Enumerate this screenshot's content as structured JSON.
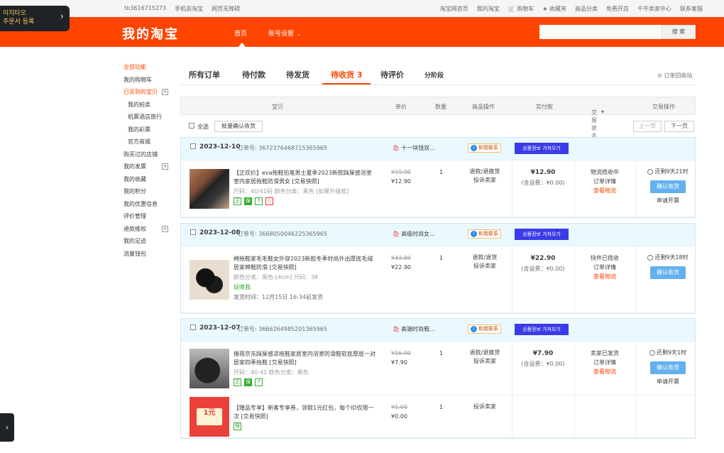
{
  "topbar": {
    "left": [
      "tb3616715273",
      "手机逛淘宝",
      "网页无障碍"
    ],
    "right": [
      "淘宝网首页",
      "我的淘宝",
      "购物车",
      "收藏夹",
      "商品分类",
      "免费开店",
      "千牛卖家中心",
      "联系客服"
    ]
  },
  "promo": {
    "line1": "이지타오",
    "line2": "주문서 등록",
    "arrow": "›"
  },
  "header": {
    "brand": "我的淘宝",
    "nav": [
      {
        "label": "首页"
      },
      {
        "label": "账号设置"
      }
    ],
    "nav_caret": "⌄",
    "search_btn": "搜 索"
  },
  "sidebar": {
    "items": [
      {
        "label": "全部功能",
        "style": "red"
      },
      {
        "label": "我的购物车",
        "style": ""
      },
      {
        "label": "已买到的宝贝",
        "style": "red",
        "plus": true
      },
      {
        "label": "我的拍卖",
        "style": "sub"
      },
      {
        "label": "机票酒店旅行",
        "style": "sub"
      },
      {
        "label": "我的彩票",
        "style": "sub"
      },
      {
        "label": "官方商城",
        "style": "sub"
      },
      {
        "label": "购买过的店铺",
        "style": ""
      },
      {
        "label": "我的发票",
        "style": "",
        "plus": true
      },
      {
        "label": "我的收藏",
        "style": ""
      },
      {
        "label": "我的积分",
        "style": ""
      },
      {
        "label": "我的优惠信息",
        "style": ""
      },
      {
        "label": "评价管理",
        "style": ""
      },
      {
        "label": "退款维权",
        "style": "",
        "plus": true
      },
      {
        "label": "我的足迹",
        "style": ""
      },
      {
        "label": "流量钱包",
        "style": ""
      }
    ]
  },
  "tabs": [
    {
      "label": "所有订单"
    },
    {
      "label": "待付款"
    },
    {
      "label": "待发货"
    },
    {
      "label": "待收货 3"
    },
    {
      "label": "待评价"
    },
    {
      "label": "分阶段"
    }
  ],
  "recycle": "订单回收站",
  "columns": [
    "宝贝",
    "单价",
    "数量",
    "商品操作",
    "实付款",
    "交易状态",
    "交易操作"
  ],
  "status_caret": "▾",
  "select_all": {
    "label": "全选",
    "button": "批量确认收货",
    "prev": "上一页",
    "next": "下一页"
  },
  "orders": [
    {
      "date": "2023-12-10",
      "order_no": "订单号: 3672376468715365965",
      "shop": "十一块钱双...",
      "chat": "和我联系",
      "qr": "상품정보 가져오기",
      "items": [
        {
          "title": "【正欢价】eva拖鞋铅笔男士夏季2023新款踩屎感浴室室内家居拖鞋防滑男女 [交易快照]",
          "spec": "尺码：40/41码  颜色分类：黑色  [如果升级款]",
          "badges": [
            "正",
            "保",
            "7",
            "◇"
          ],
          "old": "¥19.90",
          "now": "¥12.90",
          "qty": "1",
          "ops": [
            "退款/退换货",
            "投诉卖家"
          ],
          "paid": "¥12.90",
          "ship": "(含运费：¥0.00)",
          "status": [
            "物流揽收中",
            "订单详情",
            "查看物流"
          ],
          "timer": "还剩9天21时",
          "btn": "确认收货",
          "link": "申请开票"
        }
      ]
    },
    {
      "date": "2023-12-08",
      "order_no": "订单号: 3668050046225365965",
      "shop": "高级时尚女...",
      "chat": "和我联系",
      "qr": "상품정보 가져오기",
      "items": [
        {
          "title": "棉拖鞋家毛毛鞋女外穿2023新款冬季时尚外出厚底毛绒居家棉鞋防滑 [交易快照]",
          "spec": "颜色分类：黑色-[4cm]  尺码：38",
          "promo": "促唤我",
          "ship_time": "发货时间：12月15日 16:34前发货",
          "old": "¥43.80",
          "now": "¥22.90",
          "qty": "1",
          "ops": [
            "退款/退货",
            "投诉卖家"
          ],
          "paid": "¥22.90",
          "ship": "(含运费：¥0.00)",
          "status": [
            "快件已揽收",
            "订单详情",
            "查看物流"
          ],
          "timer": "还剩9天18时",
          "btn": "确认收货"
        }
      ]
    },
    {
      "date": "2023-12-07",
      "order_no": "订单号: 3666264985201365965",
      "shop": "高端时尚鞋...",
      "chat": "和我联系",
      "qr": "상품정보 가져오기",
      "items": [
        {
          "title": "倩蓓京东踩屎感凉拖鞋家居室内浴室防滑鞋软底厚底一对居家四季拖鞋 [交易快照]",
          "spec": "尺码：40-41  颜色分类：黑色",
          "badges": [
            "正",
            "保",
            "7"
          ],
          "old": "¥16.00",
          "now": "¥7.90",
          "qty": "1",
          "ops": [
            "退款/退换货",
            "投诉卖家"
          ],
          "paid": "¥7.90",
          "ship": "(含运费：¥0.00)",
          "status": [
            "卖家已发货",
            "订单详情",
            "查看物流"
          ],
          "timer": "还剩9天1时",
          "btn": "确认收货",
          "link": "申请开票"
        },
        {
          "title": "【赠品专享】新客专享券，领取1元红包，每个ID仅限一次 [交易快照]",
          "badges": [
            "保"
          ],
          "coupon_text": "1元",
          "old": "¥1.00",
          "now": "¥0.00",
          "qty": "1",
          "ops": [
            "投诉卖家"
          ]
        }
      ]
    }
  ],
  "sidetab": "›",
  "colors": {
    "brand": "#ff4400",
    "order_head": "#eaf8ff",
    "qr_btn": "#3b3be8",
    "confirm_btn": "#63b0ed"
  }
}
